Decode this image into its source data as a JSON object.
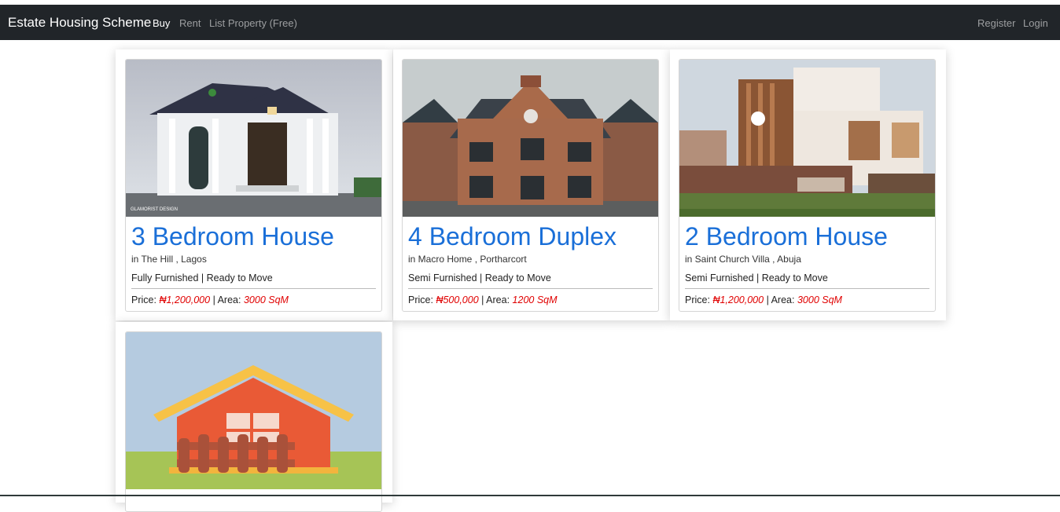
{
  "navbar": {
    "brand": "Estate Housing Scheme",
    "links": [
      "Buy",
      "Rent",
      "List Property (Free)"
    ],
    "right_links": [
      "Register",
      "Login"
    ]
  },
  "listings": [
    {
      "title": "3 Bedroom House",
      "location": "in The Hill , Lagos",
      "furnishing": "Fully Furnished | Ready to Move",
      "price_label": "Price:",
      "price": "₦1,200,000",
      "area_label": "| Area:",
      "area": "3000 SqM",
      "image": "white-mansion-photo",
      "image_caption": "GLAMORIST DESIGN"
    },
    {
      "title": "4 Bedroom Duplex",
      "location": "in Macro Home , Portharcort",
      "furnishing": "Semi Furnished | Ready to Move",
      "price_label": "Price:",
      "price": "₦500,000",
      "area_label": "| Area:",
      "area": "1200 SqM",
      "image": "brick-duplex-photo"
    },
    {
      "title": "2 Bedroom House",
      "location": "in Saint Church Villa , Abuja",
      "furnishing": "Semi Furnished | Ready to Move",
      "price_label": "Price:",
      "price": "₦1,200,000",
      "area_label": "| Area:",
      "area": "3000 SqM",
      "image": "modern-villa-photo"
    },
    {
      "image": "house-illustration"
    }
  ],
  "colors": {
    "navbar_bg": "#212529",
    "title_blue": "#1a6fd8",
    "price_red": "#e00000"
  }
}
